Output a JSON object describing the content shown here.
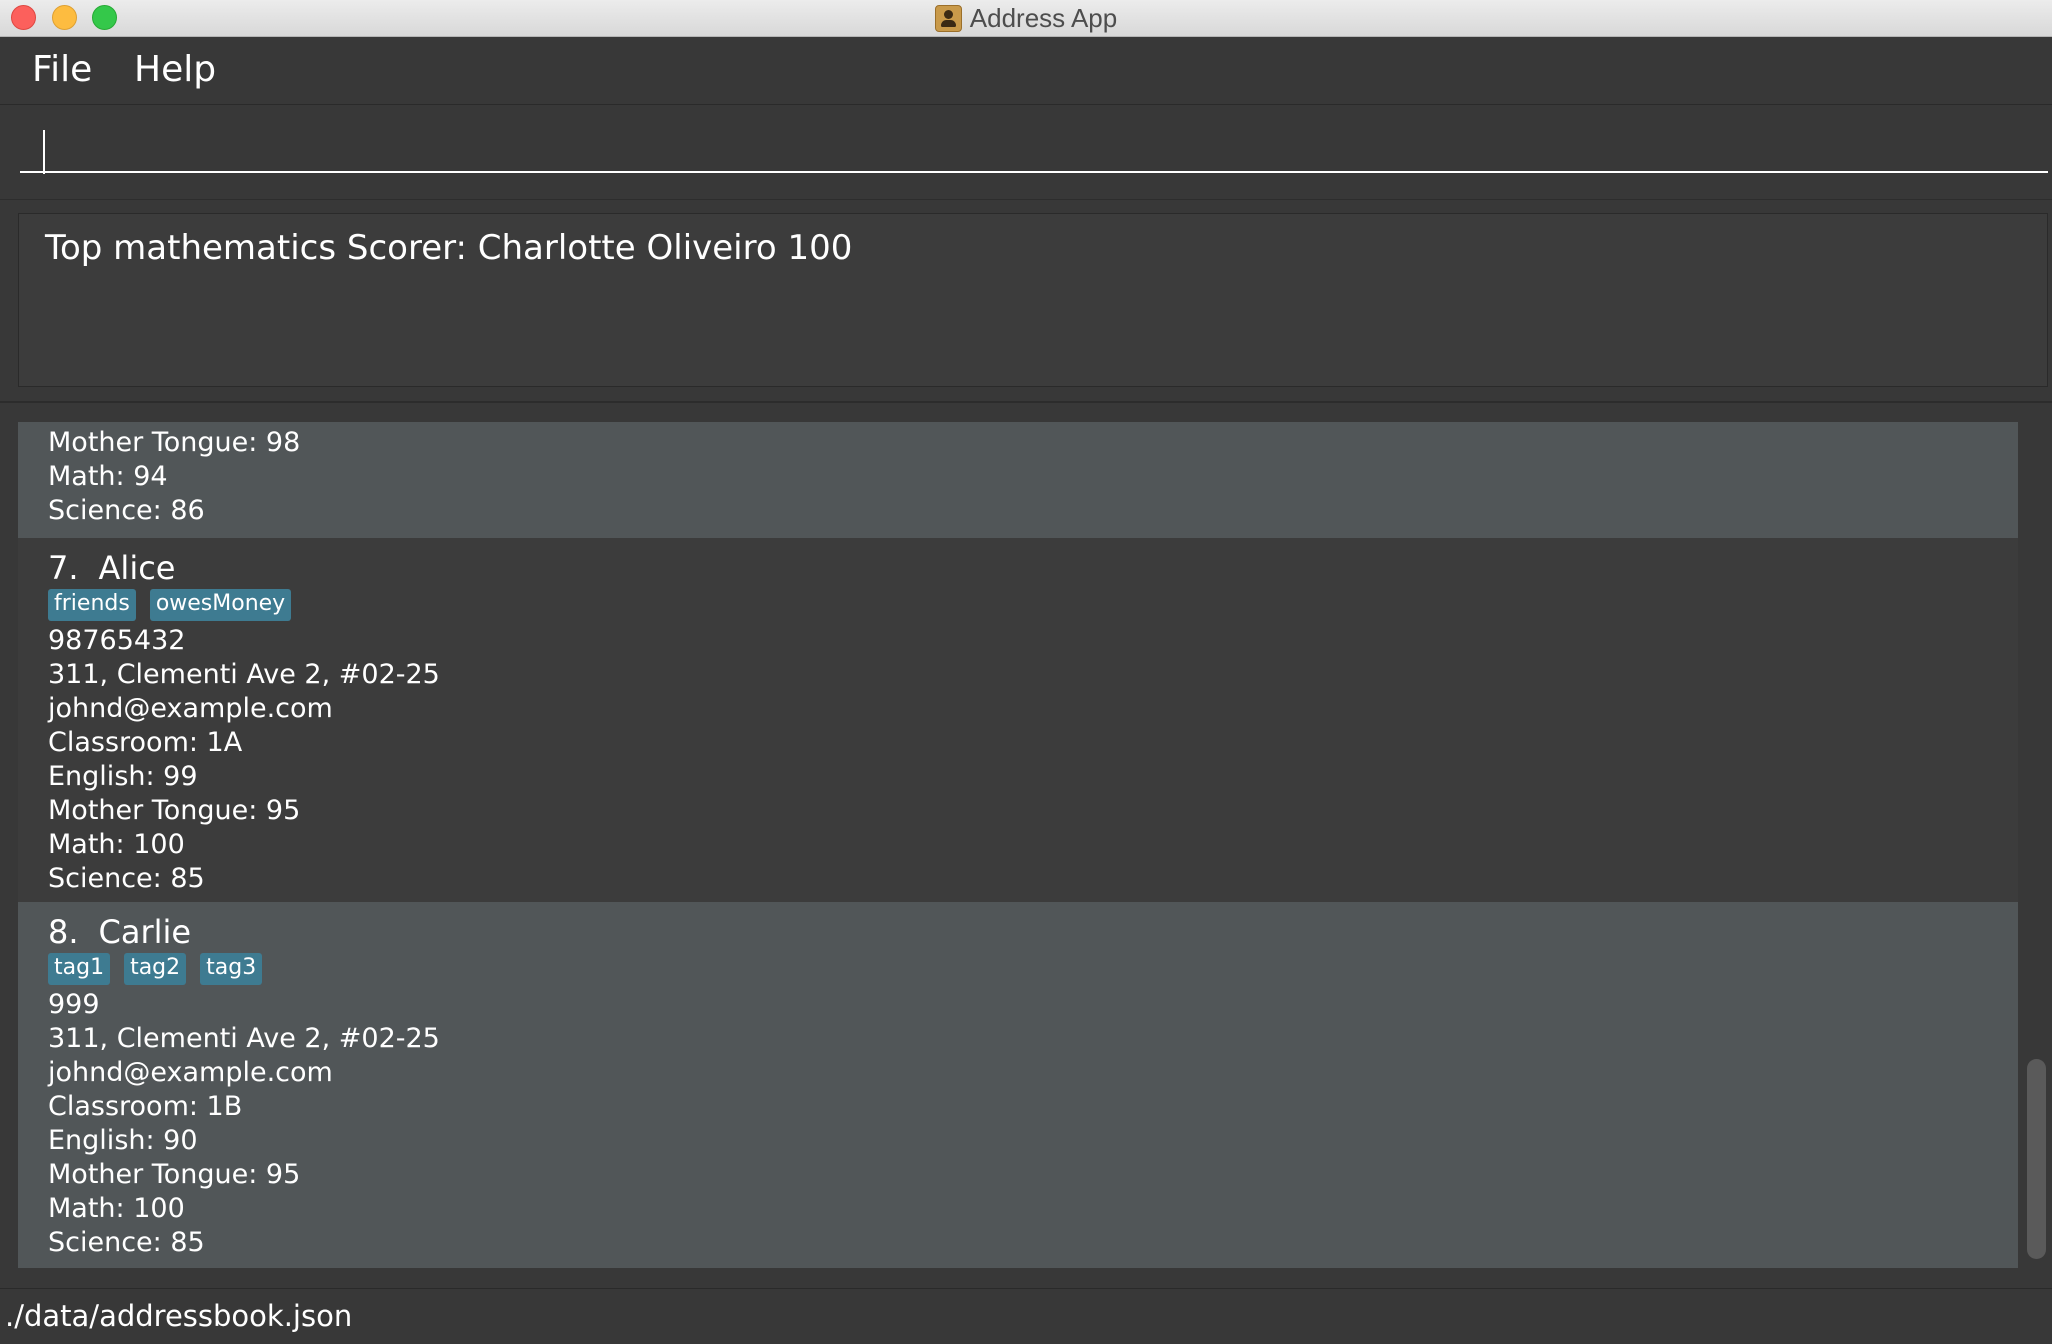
{
  "window": {
    "title": "Address App",
    "icon": "address-book-icon"
  },
  "menu": {
    "file": "File",
    "help": "Help"
  },
  "command": {
    "value": "",
    "placeholder": ""
  },
  "result": {
    "text": "Top mathematics Scorer: Charlotte Oliveiro 100"
  },
  "persons": [
    {
      "index": "",
      "name": "",
      "tags": [],
      "lines": [
        "Mother Tongue: 98",
        "Math: 94",
        "Science: 86"
      ]
    },
    {
      "index": "7.",
      "name": "Alice",
      "tags": [
        "friends",
        "owesMoney"
      ],
      "lines": [
        "98765432",
        "311, Clementi Ave 2, #02-25",
        "johnd@example.com",
        "Classroom: 1A",
        "English: 99",
        "Mother Tongue: 95",
        "Math: 100",
        "Science: 85"
      ]
    },
    {
      "index": "8.",
      "name": "Carlie",
      "tags": [
        "tag1",
        "tag2",
        "tag3"
      ],
      "lines": [
        "999",
        "311, Clementi Ave 2, #02-25",
        "johnd@example.com",
        "Classroom: 1B",
        "English: 90",
        "Mother Tongue: 95",
        "Math: 100",
        "Science: 85"
      ]
    }
  ],
  "status": {
    "path": "./data/addressbook.json"
  },
  "colors": {
    "background": "#383838",
    "card_odd": "#515658",
    "card_even": "#3c3c3c",
    "tag": "#3e7b91"
  }
}
